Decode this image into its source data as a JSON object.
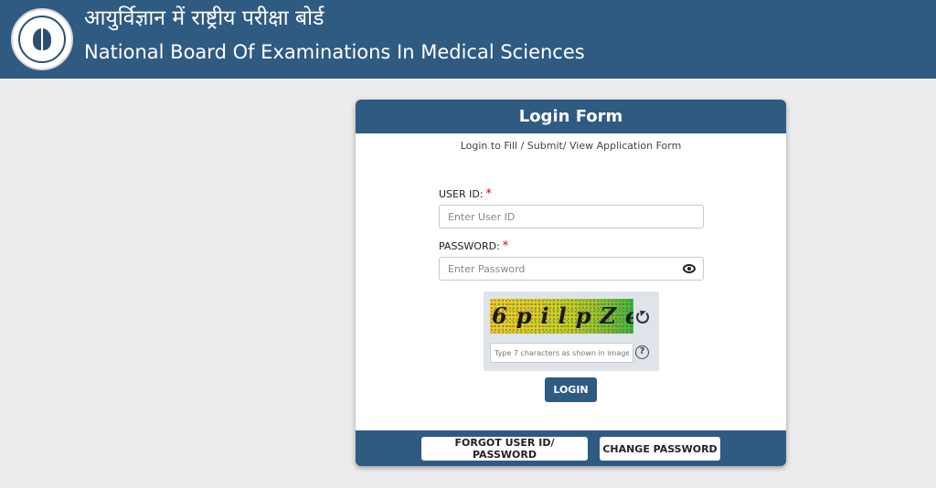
{
  "header": {
    "title_hindi": "आयुर्विज्ञान में राष्ट्रीय परीक्षा बोर्ड",
    "title_english": "National Board Of Examinations In Medical Sciences",
    "logo_icon": "nbems-emblem-logo"
  },
  "login_form": {
    "title": "Login Form",
    "subtitle": "Login to Fill / Submit/ View Application Form",
    "user_id": {
      "label": "USER ID:",
      "required_marker": "*",
      "placeholder": "Enter User ID",
      "value": ""
    },
    "password": {
      "label": "PASSWORD:",
      "required_marker": "*",
      "placeholder": "Enter Password",
      "value": "",
      "toggle_icon": "eye-icon"
    },
    "captcha": {
      "image_text": "6pilpZe",
      "refresh_icon": "refresh-icon",
      "placeholder": "Type 7 characters as shown in image",
      "value": "",
      "help_symbol": "?"
    },
    "login_button": "LOGIN",
    "forgot_button": "FORGOT USER ID/ PASSWORD",
    "change_password_button": "CHANGE PASSWORD"
  },
  "colors": {
    "brand_blue": "#2f5a82",
    "page_background": "#ececec",
    "required_red": "#e00000"
  }
}
